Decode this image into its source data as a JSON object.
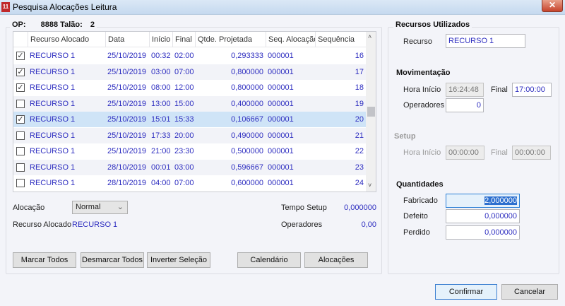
{
  "window": {
    "title": "Pesquisa Alocações Leitura",
    "close_icon": "close-icon"
  },
  "header": {
    "op_label": "OP:",
    "op_value": "8888",
    "talao_label": "Talão:",
    "talao_value": "2"
  },
  "grid": {
    "columns": [
      "Recurso Alocado",
      "Data",
      "Início",
      "Final",
      "Qtde. Projetada",
      "Seq. Alocação",
      "Sequência"
    ],
    "rows": [
      {
        "checked": true,
        "recurso": "RECURSO 1",
        "data": "25/10/2019",
        "inicio": "00:32",
        "final": "02:00",
        "qtde": "0,293333",
        "seq_aloc": "000001",
        "seq": "16"
      },
      {
        "checked": true,
        "recurso": "RECURSO 1",
        "data": "25/10/2019",
        "inicio": "03:00",
        "final": "07:00",
        "qtde": "0,800000",
        "seq_aloc": "000001",
        "seq": "17"
      },
      {
        "checked": true,
        "recurso": "RECURSO 1",
        "data": "25/10/2019",
        "inicio": "08:00",
        "final": "12:00",
        "qtde": "0,800000",
        "seq_aloc": "000001",
        "seq": "18"
      },
      {
        "checked": false,
        "recurso": "RECURSO 1",
        "data": "25/10/2019",
        "inicio": "13:00",
        "final": "15:00",
        "qtde": "0,400000",
        "seq_aloc": "000001",
        "seq": "19"
      },
      {
        "checked": true,
        "selected": true,
        "recurso": "RECURSO 1",
        "data": "25/10/2019",
        "inicio": "15:01",
        "final": "15:33",
        "qtde": "0,106667",
        "seq_aloc": "000001",
        "seq": "20"
      },
      {
        "checked": false,
        "recurso": "RECURSO 1",
        "data": "25/10/2019",
        "inicio": "17:33",
        "final": "20:00",
        "qtde": "0,490000",
        "seq_aloc": "000001",
        "seq": "21"
      },
      {
        "checked": false,
        "recurso": "RECURSO 1",
        "data": "25/10/2019",
        "inicio": "21:00",
        "final": "23:30",
        "qtde": "0,500000",
        "seq_aloc": "000001",
        "seq": "22"
      },
      {
        "checked": false,
        "recurso": "RECURSO 1",
        "data": "28/10/2019",
        "inicio": "00:01",
        "final": "03:00",
        "qtde": "0,596667",
        "seq_aloc": "000001",
        "seq": "23"
      },
      {
        "checked": false,
        "recurso": "RECURSO 1",
        "data": "28/10/2019",
        "inicio": "04:00",
        "final": "07:00",
        "qtde": "0,600000",
        "seq_aloc": "000001",
        "seq": "24"
      }
    ]
  },
  "info": {
    "alocacao_label": "Alocação",
    "alocacao_value": "Normal",
    "recurso_alocado_label": "Recurso Alocado",
    "recurso_alocado_value": "RECURSO 1",
    "tempo_setup_label": "Tempo Setup",
    "tempo_setup_value": "0,000000",
    "operadores_label": "Operadores",
    "operadores_value": "0,00"
  },
  "buttons": {
    "marcar_todos": "Marcar Todos",
    "desmarcar_todos": "Desmarcar Todos",
    "inverter": "Inverter Seleção",
    "calendario": "Calendário",
    "alocacoes": "Alocações",
    "confirmar": "Confirmar",
    "cancelar": "Cancelar"
  },
  "right": {
    "title": "Recursos Utilizados",
    "recurso_label": "Recurso",
    "recurso_value": "RECURSO 1",
    "mov_title": "Movimentação",
    "mov_hora_inicio_label": "Hora Início",
    "mov_hora_inicio_value": "16:24:48",
    "mov_final_label": "Final",
    "mov_final_value": "17:00:00",
    "mov_operadores_label": "Operadores",
    "mov_operadores_value": "0",
    "setup_title": "Setup",
    "setup_hora_inicio_label": "Hora Início",
    "setup_hora_inicio_value": "00:00:00",
    "setup_final_label": "Final",
    "setup_final_value": "00:00:00",
    "qtd_title": "Quantidades",
    "fabricado_label": "Fabricado",
    "fabricado_value": "2,000000",
    "defeito_label": "Defeito",
    "defeito_value": "0,000000",
    "perdido_label": "Perdido",
    "perdido_value": "0,000000"
  }
}
